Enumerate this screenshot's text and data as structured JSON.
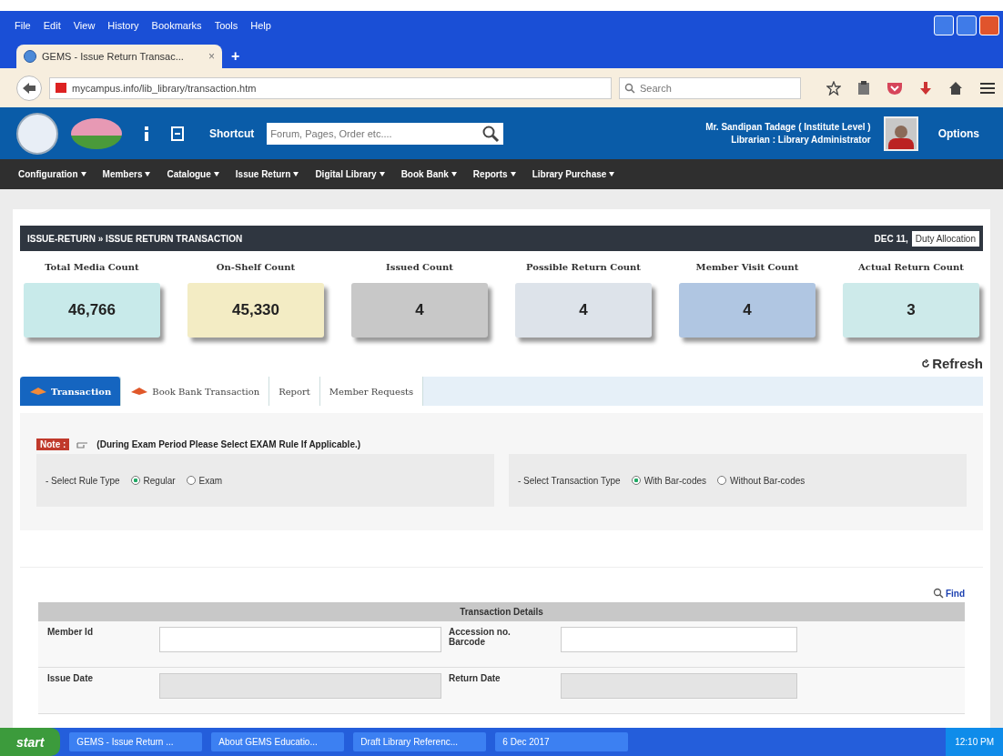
{
  "browser": {
    "menu": [
      "File",
      "Edit",
      "View",
      "History",
      "Bookmarks",
      "Tools",
      "Help"
    ],
    "tab": {
      "title": "GEMS - Issue Return Transac...",
      "close": "×"
    },
    "new_tab": "+",
    "address": "mycampus.info/lib_library/transaction.htm",
    "search_placeholder": "Search"
  },
  "header": {
    "shortcut": "Shortcut",
    "search_placeholder": "Forum, Pages, Order etc....",
    "user_name": "Mr. Sandipan Tadage ( Institute Level )",
    "user_role": "Librarian : Library Administrator",
    "options": "Options"
  },
  "nav": [
    "Configuration",
    "Members",
    "Catalogue",
    "Issue Return",
    "Digital Library",
    "Book Bank",
    "Reports",
    "Library Purchase"
  ],
  "breadcrumb": "ISSUE-RETURN » ISSUE RETURN TRANSACTION",
  "date": "DEC 11,",
  "duty_button": "Duty Allocation",
  "stats": [
    {
      "label": "Total Media Count",
      "value": "46,766",
      "color": "#c8eaea"
    },
    {
      "label": "On-Shelf Count",
      "value": "45,330",
      "color": "#f3ecc4"
    },
    {
      "label": "Issued Count",
      "value": "4",
      "color": "#c8c8c8"
    },
    {
      "label": "Possible Return Count",
      "value": "4",
      "color": "#dde3ea"
    },
    {
      "label": "Member Visit Count",
      "value": "4",
      "color": "#b0c6e2"
    },
    {
      "label": "Actual Return Count",
      "value": "3",
      "color": "#cdeaea"
    }
  ],
  "refresh": "Refresh",
  "tabs": [
    {
      "label": "Transaction",
      "selected": true
    },
    {
      "label": "Book Bank Transaction",
      "selected": false
    },
    {
      "label": "Report",
      "selected": false
    },
    {
      "label": "Member Requests",
      "selected": false
    }
  ],
  "note": {
    "badge": "Note :",
    "text": "(During Exam Period Please Select EXAM Rule If Applicable.)"
  },
  "selectors": [
    {
      "label": "- Select Rule Type",
      "options": [
        {
          "label": "Regular",
          "selected": true
        },
        {
          "label": "Exam",
          "selected": false
        }
      ]
    },
    {
      "label": "- Select Transaction Type",
      "options": [
        {
          "label": "With Bar-codes",
          "selected": true
        },
        {
          "label": "Without Bar-codes",
          "selected": false
        }
      ]
    }
  ],
  "find": "Find",
  "details": {
    "title": "Transaction Details",
    "rows": [
      [
        {
          "label": "Member Id",
          "disabled": false
        },
        {
          "label": "Accession no. Barcode",
          "disabled": false
        }
      ],
      [
        {
          "label": "Issue Date",
          "disabled": true
        },
        {
          "label": "Return Date",
          "disabled": true
        }
      ]
    ]
  },
  "taskbar": {
    "start": "start",
    "items": [
      "GEMS - Issue Return ...",
      "About GEMS Educatio...",
      "Draft Library Referenc...",
      "6 Dec 2017"
    ],
    "clock": "12:10 PM"
  }
}
